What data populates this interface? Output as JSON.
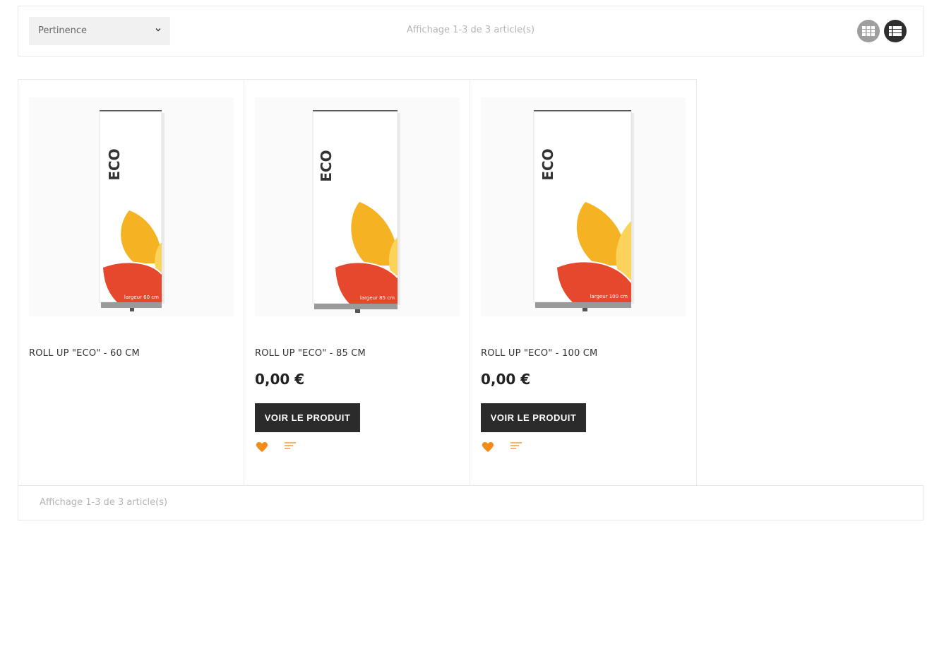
{
  "toolbar": {
    "sort_label": "Pertinence",
    "count_text": "Affichage 1-3 de 3 article(s)"
  },
  "products": [
    {
      "name": "ROLL UP \"ECO\" - 60 CM",
      "banner_text": "ECO",
      "width_label": "largeur 60 cm"
    },
    {
      "name": "ROLL UP \"ECO\" - 85 CM",
      "banner_text": "ECO",
      "width_label": "largeur 85 cm",
      "price": "0,00 €",
      "button": "VOIR LE PRODUIT"
    },
    {
      "name": "ROLL UP \"ECO\" - 100 CM",
      "banner_text": "ECO",
      "width_label": "largeur 100 cm",
      "price": "0,00 €",
      "button": "VOIR LE PRODUIT"
    }
  ],
  "footer": {
    "count_text": "Affichage 1-3 de 3 article(s)"
  },
  "icons": {
    "sort": "chevron-down-icon",
    "view_grid": "grid-view-icon",
    "view_list": "list-view-icon",
    "wishlist": "heart-icon",
    "compare": "compare-icon"
  },
  "colors": {
    "accent": "#f28c1a",
    "button_bg": "#2b2b2b",
    "petal_orange": "#f5b324",
    "petal_yellow": "#fcd35a",
    "petal_red": "#e5482c"
  }
}
